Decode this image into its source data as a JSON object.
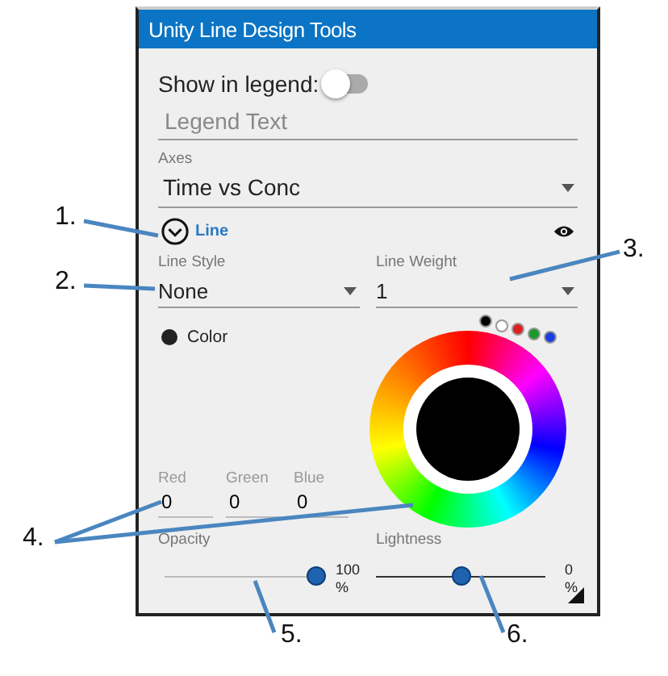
{
  "window": {
    "title": "Unity Line Design Tools"
  },
  "show_in_legend": {
    "label": "Show in legend:",
    "on": false
  },
  "legend_text": {
    "placeholder": "Legend Text"
  },
  "axes": {
    "label": "Axes",
    "value": "Time vs Conc"
  },
  "line_section": {
    "title": "Line",
    "expanded": true
  },
  "line_style": {
    "label": "Line Style",
    "value": "None"
  },
  "line_weight": {
    "label": "Line Weight",
    "value": "1"
  },
  "color": {
    "label": "Color"
  },
  "swatches": [
    {
      "color": "#000000"
    },
    {
      "color": "#ffffff"
    },
    {
      "color": "#e02020"
    },
    {
      "color": "#1a9a2a"
    },
    {
      "color": "#1a3ee0"
    }
  ],
  "rgb": [
    {
      "label": "Red",
      "value": "0"
    },
    {
      "label": "Green",
      "value": "0"
    },
    {
      "label": "Blue",
      "value": "0"
    }
  ],
  "opacity": {
    "label": "Opacity",
    "level": 1,
    "reading": "100 %"
  },
  "lightness": {
    "label": "Lightness",
    "level": 0.5,
    "reading": "0 %"
  },
  "callouts": [
    {
      "label": "1."
    },
    {
      "label": "2."
    },
    {
      "label": "3."
    },
    {
      "label": "4."
    },
    {
      "label": "5."
    },
    {
      "label": "6."
    }
  ]
}
